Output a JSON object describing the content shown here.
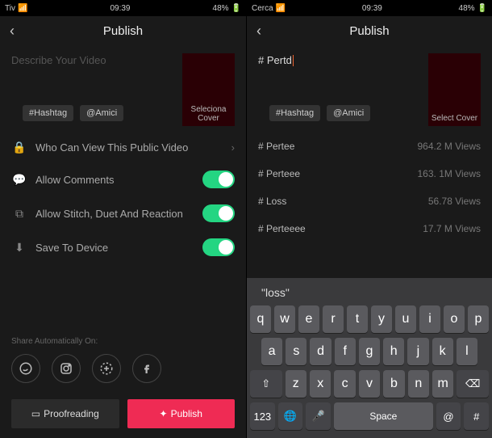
{
  "statusA": {
    "carrier": "Tiv",
    "time": "09:39",
    "battery": "48%"
  },
  "statusB": {
    "carrier": "Cerca",
    "time": "09:39",
    "battery": "48%"
  },
  "header": {
    "title": "Publish"
  },
  "compose": {
    "placeholder": "Describe Your Video",
    "typed": "# Pertd",
    "coverA": "Seleciona  Cover",
    "coverB": "Select  Cover"
  },
  "chips": {
    "hash": "#Hashtag",
    "friends": "@Amici"
  },
  "rows": {
    "privacy": "Who Can View This Public Video",
    "comments": "Allow Comments",
    "stitch": "Allow Stitch, Duet And Reaction",
    "save": "Save To Device"
  },
  "shareLabel": "Share Automatically On:",
  "buttons": {
    "draft": "Proofreading",
    "publish": "Publish"
  },
  "suggestions": [
    {
      "tag": "# Pertee",
      "count": "964.2 M Views"
    },
    {
      "tag": "# Perteee",
      "count": "163. 1M Views"
    },
    {
      "tag": "# Loss",
      "count": "56.78  Views"
    },
    {
      "tag": "# Perteeee",
      "count": "17.7 M Views"
    }
  ],
  "keyboard": {
    "suggest": "\"loss\"",
    "r1": [
      "q",
      "w",
      "e",
      "r",
      "t",
      "y",
      "u",
      "i",
      "o",
      "p"
    ],
    "r2": [
      "a",
      "s",
      "d",
      "f",
      "g",
      "h",
      "j",
      "k",
      "l"
    ],
    "r3shift": "⇧",
    "r3": [
      "z",
      "x",
      "c",
      "v",
      "b",
      "n",
      "m"
    ],
    "r3del": "⌫",
    "r4": {
      "num": "123",
      "globe": "🌐",
      "mic": "🎤",
      "space": "Space",
      "at": "@",
      "hash": "#"
    }
  }
}
